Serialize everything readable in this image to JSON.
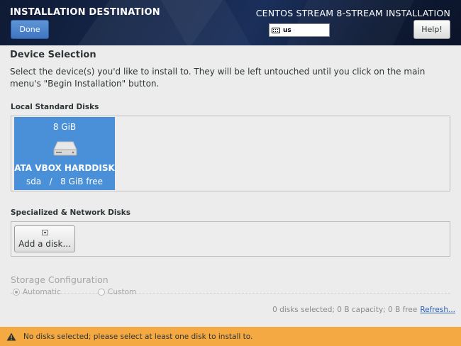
{
  "header": {
    "title": "INSTALLATION DESTINATION",
    "done_label": "Done",
    "product": "CENTOS STREAM 8-STREAM INSTALLATION",
    "keyboard_layout": "us",
    "help_label": "Help!"
  },
  "device_selection": {
    "heading": "Device Selection",
    "description": "Select the device(s) you'd like to install to.  They will be left untouched until you click on the main menu's \"Begin Installation\" button."
  },
  "local_disks": {
    "heading": "Local Standard Disks",
    "disks": [
      {
        "size": "8 GiB",
        "name": "ATA VBOX HARDDISK",
        "free": "sda   /   8 GiB free"
      }
    ]
  },
  "specialized": {
    "heading": "Specialized & Network Disks",
    "add_label": "Add a disk..."
  },
  "storage": {
    "heading": "Storage Configuration",
    "automatic_label": "Automatic",
    "custom_label": "Custom"
  },
  "summary": {
    "text": "0 disks selected; 0 B capacity; 0 B free",
    "refresh_label": "Refresh..."
  },
  "warning": {
    "text": "No disks selected; please select at least one disk to install to."
  },
  "colors": {
    "accent": "#4a90d9",
    "warning_bar": "#f4a942",
    "header_bg": "#16284d"
  }
}
